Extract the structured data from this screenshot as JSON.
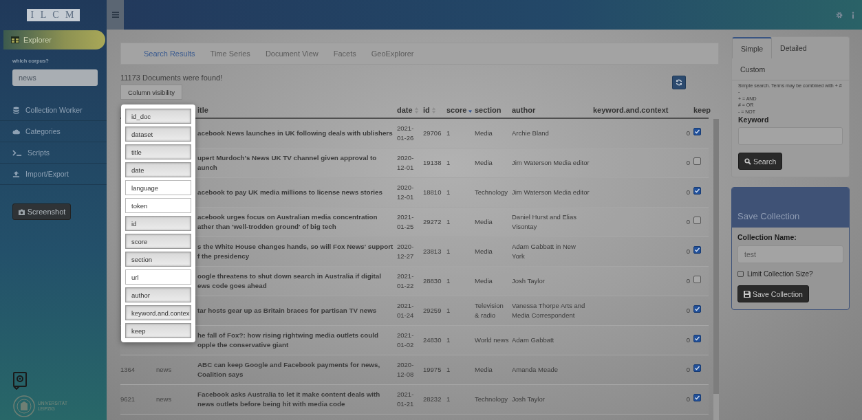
{
  "sidebar": {
    "logo": "I L C M",
    "explorer": {
      "label": "Explorer",
      "selected": true
    },
    "corpus": {
      "label": "which corpus?",
      "value": "news"
    },
    "items": [
      {
        "label": "Collection Worker",
        "selected": false
      },
      {
        "label": "Categories",
        "selected": false
      },
      {
        "label": "Scripts",
        "selected": false
      },
      {
        "label": "Import/Export",
        "selected": false
      }
    ],
    "screenshot_button": "Screenshot",
    "university": "UNIVERSITÄT LEIPZIG"
  },
  "main": {
    "tabs": [
      {
        "label": "Search Results",
        "selected": true
      },
      {
        "label": "Time Series",
        "selected": false
      },
      {
        "label": "Document View",
        "selected": false
      },
      {
        "label": "Facets",
        "selected": false
      },
      {
        "label": "GeoExplorer",
        "selected": false
      }
    ],
    "result_count": "11173 Documents were found!",
    "column_visibility_button": "Column visibility",
    "column_menu": [
      {
        "label": "id_doc",
        "active": true
      },
      {
        "label": "dataset",
        "active": true
      },
      {
        "label": "title",
        "active": true
      },
      {
        "label": "date",
        "active": true
      },
      {
        "label": "language",
        "active": false
      },
      {
        "label": "token",
        "active": false
      },
      {
        "label": "id",
        "active": true
      },
      {
        "label": "score",
        "active": true
      },
      {
        "label": "section",
        "active": true
      },
      {
        "label": "url",
        "active": false
      },
      {
        "label": "author",
        "active": true
      },
      {
        "label": "keyword.and.contex",
        "active": true
      },
      {
        "label": "keep",
        "active": true
      }
    ],
    "table": {
      "columns": [
        {
          "label": "itle",
          "sortable": false,
          "sorted": false
        },
        {
          "label": "date",
          "sortable": true,
          "sorted": false
        },
        {
          "label": "id",
          "sortable": true,
          "sorted": false
        },
        {
          "label": "score",
          "sortable": true,
          "sorted": true
        },
        {
          "label": "section",
          "sortable": false,
          "sorted": false
        },
        {
          "label": "author",
          "sortable": false,
          "sorted": false
        },
        {
          "label": "keyword.and.context",
          "sortable": false,
          "sorted": false
        },
        {
          "label": "keep",
          "sortable": false,
          "sorted": false
        }
      ],
      "rows": [
        {
          "title": "acebook News launches in UK following deals with ublishers",
          "date": "2021-01-26",
          "id": "29706",
          "score": "1",
          "section": "Media",
          "author": "Archie Bland",
          "keyword_and_context": "0",
          "keep": true
        },
        {
          "title": "upert Murdoch's News UK TV channel given approval to aunch",
          "date": "2020-12-01",
          "id": "19138",
          "score": "1",
          "section": "Media",
          "author": "Jim Waterson Media editor",
          "keyword_and_context": "0",
          "keep": false
        },
        {
          "title": "acebook to pay UK media millions to license news stories",
          "date": "2020-12-01",
          "id": "18810",
          "score": "1",
          "section": "Technology",
          "author": "Jim Waterson Media editor",
          "keyword_and_context": "0",
          "keep": true
        },
        {
          "title": "acebook urges focus on Australian media concentration ather than 'well-trodden ground' of big tech",
          "date": "2021-01-25",
          "id": "29272",
          "score": "1",
          "section": "Media",
          "author": "Daniel Hurst and Elias Visontay",
          "keyword_and_context": "0",
          "keep": false
        },
        {
          "title": "s the White House changes hands, so will Fox News' support f the presidency",
          "date": "2020-12-27",
          "id": "23813",
          "score": "1",
          "section": "Media",
          "author": "Adam Gabbatt in New York",
          "keyword_and_context": "0",
          "keep": true
        },
        {
          "title": "oogle threatens to shut down search in Australia if digital ews code goes ahead",
          "date": "2021-01-22",
          "id": "28830",
          "score": "1",
          "section": "Media",
          "author": "Josh Taylor",
          "keyword_and_context": "0",
          "keep": false
        },
        {
          "title": "tar hosts gear up as Britain braces for partisan TV news",
          "date": "2021-01-24",
          "id": "29259",
          "score": "1",
          "section": "Television & radio",
          "author": "Vanessa Thorpe Arts and Media Correspondent",
          "keyword_and_context": "0",
          "keep": true
        },
        {
          "title": "he fall of Fox?: how rising rightwing media outlets could opple the conservative giant",
          "date": "2021-01-02",
          "id": "24830",
          "score": "1",
          "section": "World news",
          "author": "Adam Gabbatt",
          "keyword_and_context": "0",
          "keep": true
        },
        {
          "id_doc": "1364",
          "dataset": "news",
          "title": "ABC can keep Google and Facebook payments for news, Coalition says",
          "date": "2020-12-08",
          "id": "19975",
          "score": "1",
          "section": "Media",
          "author": "Amanda Meade",
          "keyword_and_context": "0",
          "keep": true
        },
        {
          "id_doc": "9621",
          "dataset": "news",
          "title": "Facebook asks Australia to let it make content deals with news outlets before being hit with media code",
          "date": "2021-01-21",
          "id": "28232",
          "score": "1",
          "section": "Technology",
          "author": "Josh Taylor",
          "keyword_and_context": "0",
          "keep": true
        }
      ]
    }
  },
  "search_panel": {
    "tabs": [
      {
        "label": "Simple",
        "selected": true
      },
      {
        "label": "Detailed",
        "selected": false
      },
      {
        "label": "Custom",
        "selected": false
      }
    ],
    "help": [
      "Simple search. Terms may be combined with + # -",
      "+ = AND",
      "# = OR",
      "- = NOT"
    ],
    "keyword_label": "Keyword",
    "search_button": "Search"
  },
  "save_collection": {
    "title": "Save Collection",
    "name_label": "Collection Name:",
    "name_value": "test",
    "limit": {
      "label": "Limit Collection Size?",
      "checked": false
    },
    "button": "Save Collection"
  }
}
